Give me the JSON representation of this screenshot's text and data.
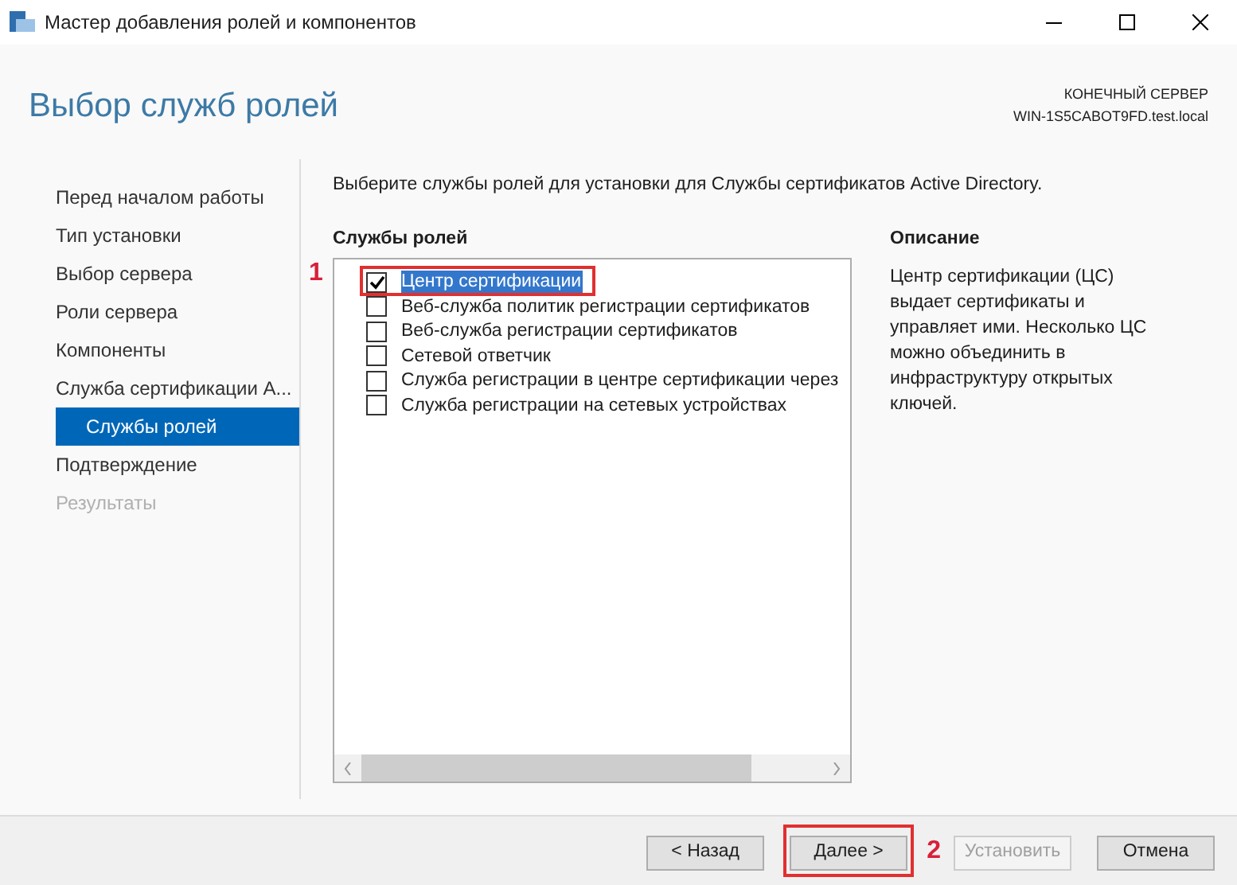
{
  "window": {
    "title": "Мастер добавления ролей и компонентов"
  },
  "header": {
    "title": "Выбор служб ролей",
    "server_label": "КОНЕЧНЫЙ СЕРВЕР",
    "server_name": "WIN-1S5CABOT9FD.test.local"
  },
  "sidebar": {
    "items": [
      {
        "label": "Перед началом работы",
        "selected": false,
        "disabled": false
      },
      {
        "label": "Тип установки",
        "selected": false,
        "disabled": false
      },
      {
        "label": "Выбор сервера",
        "selected": false,
        "disabled": false
      },
      {
        "label": "Роли сервера",
        "selected": false,
        "disabled": false
      },
      {
        "label": "Компоненты",
        "selected": false,
        "disabled": false
      },
      {
        "label": "Служба сертификации А...",
        "selected": false,
        "disabled": false,
        "children": [
          {
            "label": "Службы ролей",
            "selected": true,
            "disabled": false
          }
        ]
      },
      {
        "label": "Подтверждение",
        "selected": false,
        "disabled": false
      },
      {
        "label": "Результаты",
        "selected": false,
        "disabled": true
      }
    ]
  },
  "instruction": "Выберите службы ролей для установки для Службы сертификатов Active Directory.",
  "role_services": {
    "heading": "Службы ролей",
    "marker": "1",
    "items": [
      {
        "label": "Центр сертификации",
        "checked": true,
        "selected": true,
        "highlighted": true
      },
      {
        "label": "Веб-служба политик регистрации сертификатов",
        "checked": false,
        "selected": false,
        "highlighted": false
      },
      {
        "label": "Веб-служба регистрации сертификатов",
        "checked": false,
        "selected": false,
        "highlighted": false
      },
      {
        "label": "Сетевой ответчик",
        "checked": false,
        "selected": false,
        "highlighted": false
      },
      {
        "label": "Служба регистрации в центре сертификации через",
        "checked": false,
        "selected": false,
        "highlighted": false
      },
      {
        "label": "Служба регистрации на сетевых устройствах",
        "checked": false,
        "selected": false,
        "highlighted": false
      }
    ]
  },
  "description": {
    "heading": "Описание",
    "text": "Центр сертификации (ЦС) выдает сертификаты и управляет ими. Несколько ЦС можно объединить в инфраструктуру открытых ключей."
  },
  "buttons": [
    {
      "label": "< Назад",
      "disabled": false,
      "highlighted": false
    },
    {
      "label": "Далее >",
      "disabled": false,
      "highlighted": true,
      "marker": "2"
    },
    {
      "label": "Установить",
      "disabled": true,
      "highlighted": false
    },
    {
      "label": "Отмена",
      "disabled": false,
      "highlighted": false
    }
  ]
}
